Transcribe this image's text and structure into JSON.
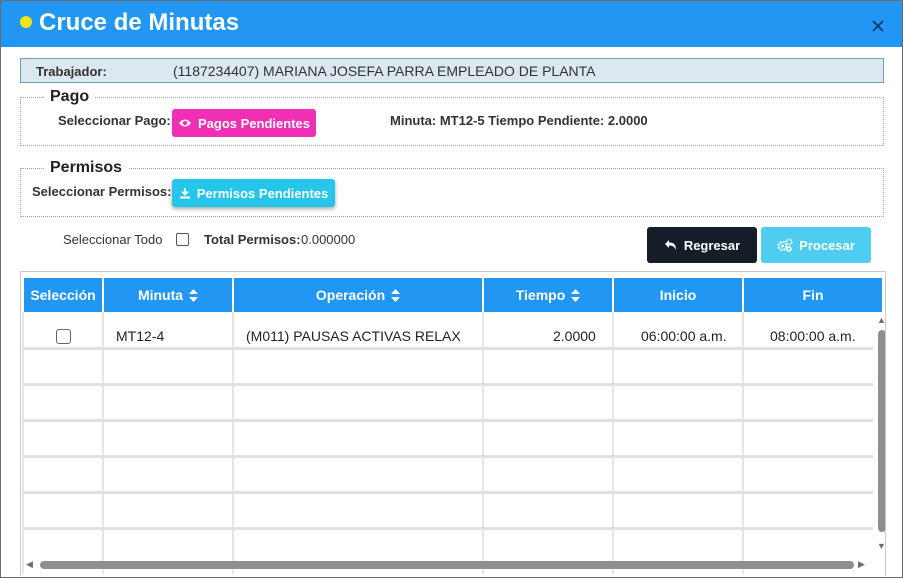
{
  "dialog": {
    "title": "Cruce de Minutas",
    "close_symbol": "×",
    "accent": "#2196f3"
  },
  "worker": {
    "label": "Trabajador:",
    "value": "(1187234407) MARIANA JOSEFA PARRA EMPLEADO DE PLANTA"
  },
  "pago": {
    "legend": "Pago",
    "select_label": "Seleccionar Pago:",
    "button_label": "Pagos Pendientes",
    "button_color": "#f02fb4",
    "info": "Minuta: MT12-5 Tiempo Pendiente: 2.0000"
  },
  "permisos": {
    "legend": "Permisos",
    "select_label": "Seleccionar Permisos:",
    "button_label": "Permisos Pendientes",
    "button_color": "#26c6ea"
  },
  "actions": {
    "select_all_label": "Seleccionar Todo",
    "total_label": "Total Permisos:",
    "total_value": "0.000000",
    "back_label": "Regresar",
    "process_label": "Procesar"
  },
  "table": {
    "columns": [
      "Selección",
      "Minuta",
      "Operación",
      "Tiempo",
      "Inicio",
      "Fin"
    ],
    "rows": [
      {
        "minuta": "MT12-4",
        "operacion": "(M011) PAUSAS ACTIVAS RELAX",
        "tiempo": "2.0000",
        "inicio": "06:00:00 a.m.",
        "fin": "08:00:00 a.m."
      }
    ]
  }
}
